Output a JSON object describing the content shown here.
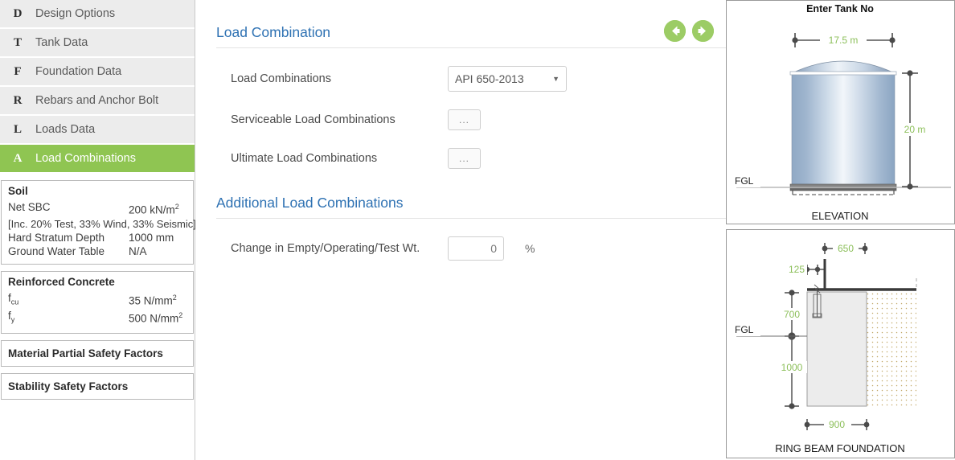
{
  "sidebar": {
    "nav_items": [
      {
        "key": "D",
        "label": "Design Options",
        "active": false
      },
      {
        "key": "T",
        "label": "Tank Data",
        "active": false
      },
      {
        "key": "F",
        "label": "Foundation Data",
        "active": false
      },
      {
        "key": "R",
        "label": "Rebars and Anchor Bolt",
        "active": false
      },
      {
        "key": "L",
        "label": "Loads Data",
        "active": false
      },
      {
        "key": "A",
        "label": "Load Combinations",
        "active": true
      }
    ],
    "soil_panel": {
      "title": "Soil",
      "net_sbc_label": "Net SBC",
      "net_sbc_value": "200 kN/m",
      "net_sbc_exp": "2",
      "note": "[Inc. 20% Test, 33% Wind, 33% Seismic]",
      "hard_stratum_label": "Hard Stratum Depth",
      "hard_stratum_value": "1000 mm",
      "gwt_label": "Ground Water Table",
      "gwt_value": "N/A"
    },
    "concrete_panel": {
      "title": "Reinforced Concrete",
      "fcu_label": "f",
      "fcu_sub": "cu",
      "fcu_value": "35 N/mm",
      "fcu_exp": "2",
      "fy_label": "f",
      "fy_sub": "y",
      "fy_value": "500 N/mm",
      "fy_exp": "2"
    },
    "material_factors_label": "Material Partial Safety Factors",
    "stability_factors_label": "Stability Safety Factors"
  },
  "main": {
    "section1_title": "Load Combination",
    "section2_title": "Additional Load Combinations",
    "load_combinations_label": "Load Combinations",
    "load_combinations_value": "API 650-2013",
    "serviceable_label": "Serviceable Load Combinations",
    "ultimate_label": "Ultimate Load Combinations",
    "dots_label": "...",
    "change_weight_label": "Change in Empty/Operating/Test Wt.",
    "change_weight_value": "0",
    "percent_unit": "%",
    "prev_icon": "arrow-left-circle-icon",
    "next_icon": "arrow-right-circle-icon",
    "accent_blue": "#2f72b3",
    "accent_green": "#9ccc65"
  },
  "diagrams": {
    "elevation": {
      "header": "Enter Tank No",
      "caption": "ELEVATION",
      "diameter": "17.5 m",
      "height": "20 m",
      "ground_label": "FGL"
    },
    "foundation": {
      "caption": "RING BEAM FOUNDATION",
      "top_width": "650",
      "wall_offset": "125",
      "upper_depth": "700",
      "lower_depth": "1000",
      "base_width": "900",
      "ground_label": "FGL"
    },
    "dim_color": "#8cbf5a"
  }
}
